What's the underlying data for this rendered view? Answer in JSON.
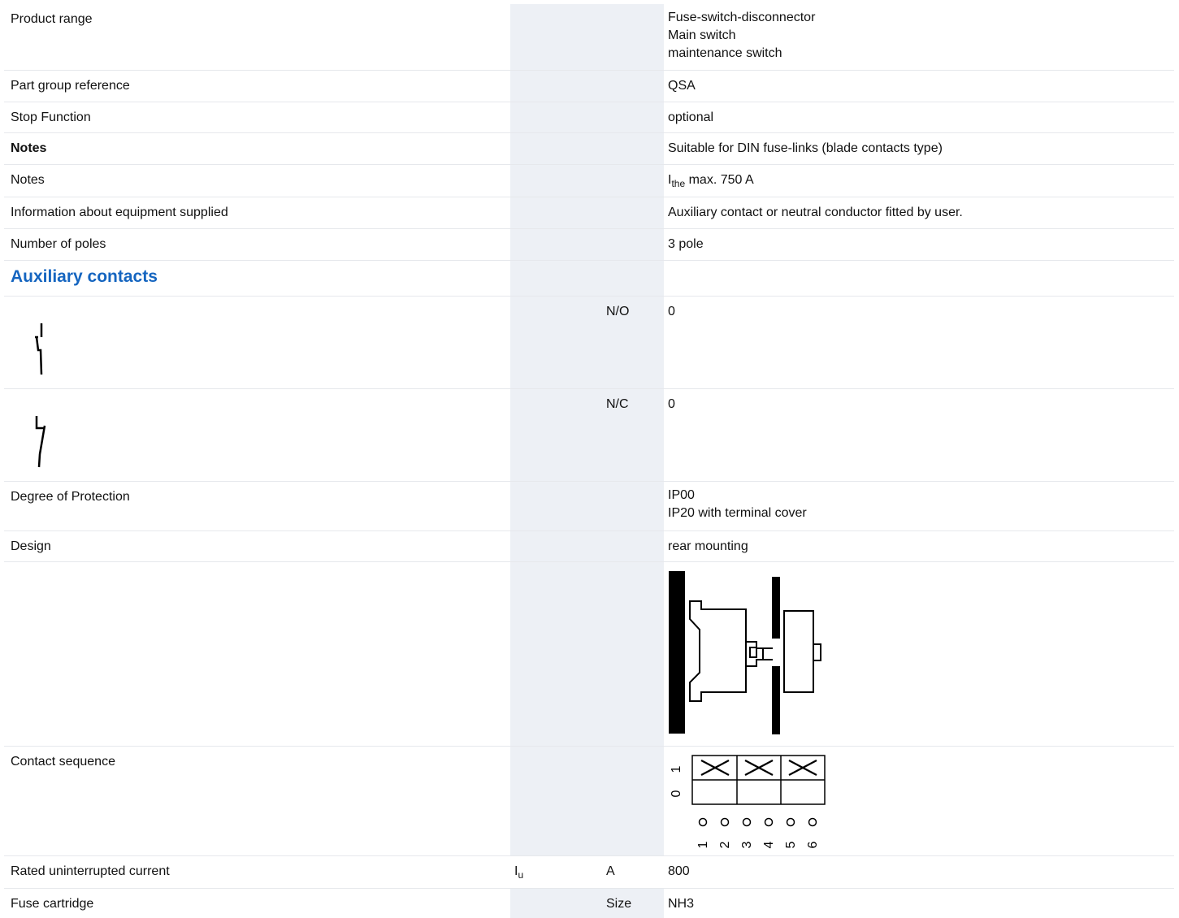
{
  "rows": {
    "product_range": {
      "label": "Product range",
      "values": [
        "Fuse-switch-disconnector",
        "Main switch",
        "maintenance switch"
      ]
    },
    "part_group": {
      "label": "Part group reference",
      "value": "QSA"
    },
    "stop_function": {
      "label": "Stop Function",
      "value": "optional"
    },
    "notes_bold": {
      "label": "Notes",
      "value": "Suitable for DIN fuse-links (blade contacts type)"
    },
    "notes": {
      "label": "Notes",
      "value_symbol": "I",
      "value_sub": "the",
      "value_rest": " max. 750 A"
    },
    "equipment_supplied": {
      "label": "Information about equipment supplied",
      "value": "Auxiliary contact or neutral conductor fitted by user."
    },
    "poles": {
      "label": "Number of poles",
      "value": "3 pole"
    },
    "aux_section": {
      "label": "Auxiliary contacts"
    },
    "aux_no": {
      "icon": "normally-open-contact-icon",
      "unit": "N/O",
      "value": "0"
    },
    "aux_nc": {
      "icon": "normally-closed-contact-icon",
      "unit": "N/C",
      "value": "0"
    },
    "protection": {
      "label": "Degree of Protection",
      "values": [
        "IP00",
        "IP20 with terminal cover"
      ]
    },
    "design": {
      "label": "Design",
      "value": "rear mounting"
    },
    "design_diagram": {
      "icon": "rear-mounting-diagram-icon"
    },
    "contact_sequence": {
      "label": "Contact sequence",
      "positions": [
        "1",
        "0"
      ],
      "terminals": [
        "1",
        "2",
        "3",
        "4",
        "5",
        "6"
      ]
    },
    "rated_current": {
      "label": "Rated uninterrupted current",
      "symbol": "I",
      "symbol_sub": "u",
      "unit": "A",
      "value": "800"
    },
    "fuse_cartridge": {
      "label": "Fuse cartridge",
      "unit": "Size",
      "value": "NH3"
    }
  }
}
